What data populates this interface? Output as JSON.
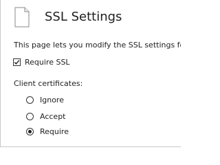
{
  "header": {
    "title": "SSL Settings",
    "icon": "document-icon"
  },
  "description": "This page lets you modify the SSL settings for the",
  "require_ssl": {
    "label": "Require SSL",
    "checked": true
  },
  "client_certificates": {
    "label": "Client certificates:",
    "options": [
      {
        "label": "Ignore",
        "selected": false
      },
      {
        "label": "Accept",
        "selected": false
      },
      {
        "label": "Require",
        "selected": true
      }
    ]
  }
}
